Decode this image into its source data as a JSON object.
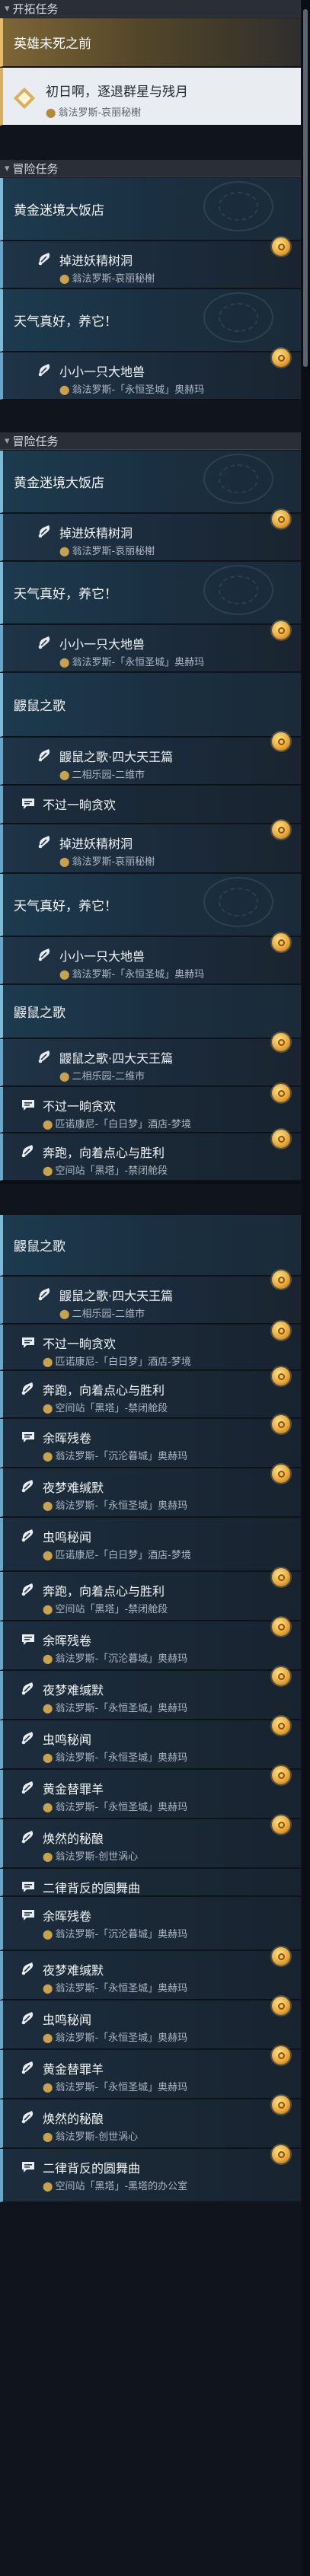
{
  "sections": {
    "trailblaze": "开拓任务",
    "adventure": "冒险任务"
  },
  "locations": {
    "wailing_woods": "翁法罗斯-哀丽秘榭",
    "okhema_aidonia": "翁法罗斯-「永恒圣城」奥赫玛",
    "twin_paradise": "二相乐园-二维市",
    "penacony_dreamscape": "匹诺康尼-「白日梦」酒店-梦境",
    "herta_sealed_cabin": "空间站「黑塔」-禁闭舱段",
    "okhema_sinking": "翁法罗斯-「沉沦暮城」奥赫玛",
    "okhema_vortex": "翁法罗斯-创世涡心",
    "herta_office": "空间站「黑塔」-黑塔的办公室"
  },
  "quest_names": {
    "heroes_before_death": "英雄未死之前",
    "sunrise_chase": "初日啊，逐退群星与残月",
    "golden_hotel": "黄金迷境大饭店",
    "demon_cave": "掉进妖精树洞",
    "nice_weather": "天气真好，养它！",
    "little_beast": "小小一只大地兽",
    "mole_song": "鼹鼠之歌",
    "mole_song_four": "鼹鼠之歌·四大天王篇",
    "no_more_joy": "不过一晌贪欢",
    "run_snacks": "奔跑，向着点心与胜利",
    "residual_scroll": "余晖残卷",
    "nightmare": "夜梦难缄默",
    "insect_secrets": "虫鸣秘闻",
    "golden_lamb": "黄金替罪羊",
    "mysterious_brew": "焕然的秘酿",
    "rondo": "二律背反的圆舞曲"
  },
  "scroll": {
    "thumb_fraction": 0.14
  }
}
